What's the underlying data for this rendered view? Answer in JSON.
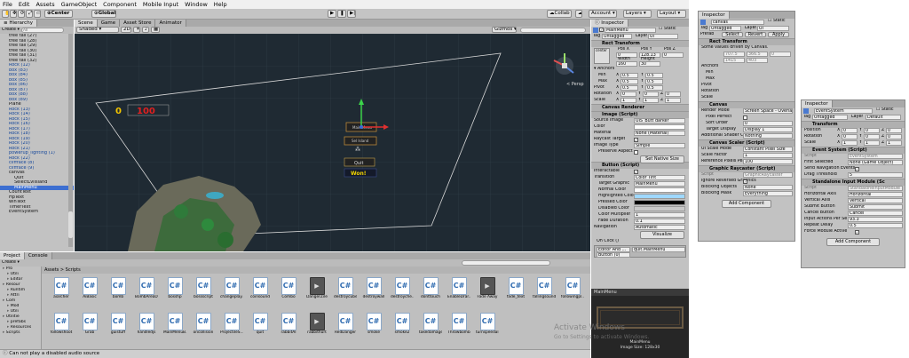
{
  "menu": [
    "File",
    "Edit",
    "Assets",
    "GameObject",
    "Component",
    "Mobile Input",
    "Window",
    "Help"
  ],
  "toolbar": {
    "center": "Center",
    "global": "Global",
    "collab": "Collab",
    "account": "Account",
    "layers": "Layers",
    "layout": "Layout"
  },
  "hierarchy": {
    "tab": "Hierarchy",
    "create": "Create",
    "search_placeholder": "All",
    "items": [
      {
        "label": "tree tall (27)",
        "kind": "normal"
      },
      {
        "label": "tree tall (28)",
        "kind": "normal"
      },
      {
        "label": "tree tall (29)",
        "kind": "normal"
      },
      {
        "label": "tree tall (30)",
        "kind": "normal"
      },
      {
        "label": "tree tall (31)",
        "kind": "normal"
      },
      {
        "label": "tree tall (32)",
        "kind": "normal"
      },
      {
        "label": "Rock (12)",
        "kind": "blue"
      },
      {
        "label": "box (83)",
        "kind": "blue"
      },
      {
        "label": "box (84)",
        "kind": "blue"
      },
      {
        "label": "box (85)",
        "kind": "blue"
      },
      {
        "label": "box (86)",
        "kind": "blue"
      },
      {
        "label": "box (87)",
        "kind": "blue"
      },
      {
        "label": "box (88)",
        "kind": "blue"
      },
      {
        "label": "box (89)",
        "kind": "blue"
      },
      {
        "label": "Plane",
        "kind": "normal"
      },
      {
        "label": "Rock (13)",
        "kind": "blue"
      },
      {
        "label": "Rock (14)",
        "kind": "blue"
      },
      {
        "label": "Rock (15)",
        "kind": "blue"
      },
      {
        "label": "Rock (16)",
        "kind": "blue"
      },
      {
        "label": "Rock (17)",
        "kind": "blue"
      },
      {
        "label": "Rock (18)",
        "kind": "blue"
      },
      {
        "label": "Rock (19)",
        "kind": "blue"
      },
      {
        "label": "Rock (20)",
        "kind": "blue"
      },
      {
        "label": "Rock (21)",
        "kind": "blue"
      },
      {
        "label": "powerup_lighting (1)",
        "kind": "blue"
      },
      {
        "label": "Rock (22)",
        "kind": "blue"
      },
      {
        "label": "cliffface (8)",
        "kind": "blue"
      },
      {
        "label": "cliffface (9)",
        "kind": "blue"
      },
      {
        "label": "canvas",
        "kind": "normal"
      },
      {
        "label": "Quit",
        "kind": "normal"
      },
      {
        "label": "SelectLvlIsland",
        "kind": "normal"
      },
      {
        "label": "MainMenu",
        "kind": "sel"
      },
      {
        "label": "CountText",
        "kind": "normal"
      },
      {
        "label": "HpText",
        "kind": "normal"
      },
      {
        "label": "winText",
        "kind": "normal"
      },
      {
        "label": "TimerText",
        "kind": "normal"
      },
      {
        "label": "EventSystem",
        "kind": "normal"
      }
    ]
  },
  "scene": {
    "tabs": [
      "Scene",
      "Game",
      "Asset Store",
      "Animator"
    ],
    "shaded": "Shaded",
    "twod": "2D",
    "gizmos": "Gizmos",
    "persp": "< Persp",
    "hud_count": "0",
    "hud_hp": "100",
    "btn_main": "Main Menu",
    "btn_lvl": "Sel Island",
    "btn_quit": "Quit",
    "btn_won": "Won!"
  },
  "project": {
    "tabs": [
      "Project",
      "Console"
    ],
    "create": "Create",
    "path": "Assets > Scripts",
    "tree": [
      "Pro",
      "Utili",
      "Editor",
      "Resour",
      "Runtim",
      "Attri",
      "Com",
      "Mod",
      "Utili",
      "Utilitie",
      "prefabs",
      "Resources",
      "Scripts"
    ],
    "assets": [
      {
        "name": "aiarcher",
        "type": "cs"
      },
      {
        "name": "AiBasic",
        "type": "cs"
      },
      {
        "name": "bomb",
        "type": "cs"
      },
      {
        "name": "BombAreaD...",
        "type": "cs"
      },
      {
        "name": "bosshp",
        "type": "cs"
      },
      {
        "name": "bossscript",
        "type": "cs"
      },
      {
        "name": "changeplay...",
        "type": "cs"
      },
      {
        "name": "coinsound",
        "type": "cs"
      },
      {
        "name": "Combo",
        "type": "cs"
      },
      {
        "name": "DangerZile",
        "type": "vid"
      },
      {
        "name": "destroycube",
        "type": "cs"
      },
      {
        "name": "destroywall",
        "type": "cs"
      },
      {
        "name": "destroyche...",
        "type": "cs"
      },
      {
        "name": "donttouch",
        "type": "cs"
      },
      {
        "name": "EnableDrar...",
        "type": "cs"
      },
      {
        "name": "Fade Away",
        "type": "vid"
      },
      {
        "name": "fade_text",
        "type": "cs"
      },
      {
        "name": "fallingsound",
        "type": "cs"
      },
      {
        "name": "followingpl...",
        "type": "cs"
      },
      {
        "name": "followshoot",
        "type": "cs"
      },
      {
        "name": "Grab",
        "type": "cs"
      },
      {
        "name": "guistuff",
        "type": "cs"
      },
      {
        "name": "handledjs",
        "type": "cs"
      },
      {
        "name": "MainMenuB...",
        "type": "cs"
      },
      {
        "name": "oncollision",
        "type": "cs"
      },
      {
        "name": "ProjectileS...",
        "type": "cs"
      },
      {
        "name": "quit",
        "type": "cs"
      },
      {
        "name": "rabbitAI",
        "type": "cs"
      },
      {
        "name": "rabbithurt",
        "type": "vid"
      },
      {
        "name": "RedDanger",
        "type": "cs"
      },
      {
        "name": "smoke",
        "type": "cs"
      },
      {
        "name": "smoke2",
        "type": "cs"
      },
      {
        "name": "takedamage",
        "type": "cs"
      },
      {
        "name": "Throwbomb",
        "type": "cs"
      },
      {
        "name": "turnspeedal...",
        "type": "cs"
      }
    ]
  },
  "status": "Can not play a disabled audio source",
  "inspector": {
    "tab": "Inspector",
    "name": "MainMenu",
    "static": "Static",
    "tag": "Untagged",
    "layer": "UI",
    "rect": {
      "title": "Rect Transform",
      "anchor": "center",
      "posx": "0",
      "posy": "128.13",
      "posz": "0",
      "width": "160",
      "height": "30"
    },
    "anchors": {
      "title": "Anchors",
      "min_x": "0.5",
      "min_y": "0.5",
      "max_x": "0.5",
      "max_y": "0.5",
      "pivot_x": "0.5",
      "pivot_y": "0.5"
    },
    "rotation": {
      "x": "0",
      "y": "0",
      "z": "0"
    },
    "scale": {
      "x": "1",
      "y": "1",
      "z": "1"
    },
    "canvas_renderer": "Canvas Renderer",
    "image": {
      "title": "Image (Script)",
      "source": "UIS_Butt darker",
      "material": "None (Material)",
      "image_type": "Simple",
      "set_native": "Set Native Size"
    },
    "button": {
      "title": "Button (Script)",
      "transition": "Color Tint",
      "target": "MainMenu",
      "fade": "0.1",
      "navigation": "Automatic",
      "visualize": "Visualize"
    },
    "onclick": "On Click ()",
    "editor": "Editor And ...",
    "func": "quit.MainMenu",
    "objref": "Button (0)",
    "labels": {
      "source_image": "Source Image",
      "color": "Color",
      "material": "Material",
      "raycast": "Raycast Target",
      "image_type": "Image Type",
      "preserve": "Preserve Aspect",
      "interactable": "Interactable",
      "transition": "Transition",
      "target_graphic": "Target Graphic",
      "normal": "Normal Color",
      "highlighted": "Highlighted Color",
      "pressed": "Pressed Color",
      "disabled": "Disabled Color",
      "multiplier": "Color Multiplier",
      "fade": "Fade Duration",
      "navigation": "Navigation",
      "anchors_min": "Min",
      "anchors_max": "Max",
      "pivot": "Pivot",
      "rotation": "Rotation",
      "scale": "Scale",
      "posx": "Pos X",
      "posy": "Pos Y",
      "posz": "Pos Z",
      "width": "Width",
      "height": "Height"
    },
    "multiplier": "1"
  },
  "preview": {
    "title": "MainMenu",
    "info": "MainMenu",
    "size": "Image Size: 128x30"
  },
  "watermark": {
    "line1": "Activate Windows",
    "line2": "Go to Settings to activate Windows."
  },
  "inspector2": {
    "tab": "Inspector",
    "name": "canvas",
    "static": "Static",
    "tag": "Untagged",
    "layer": "UI",
    "prefab": "Prefab",
    "select": "Select",
    "revert": "Revert",
    "apply": "Apply",
    "rect_title": "Rect Transform",
    "rect_note": "Some values driven by Canvas.",
    "posx": "707.5",
    "posy": "366.5",
    "posz": "0",
    "width": "1415",
    "height": "403",
    "canvas_title": "Canvas",
    "render_mode": "Screen Space - Overlay",
    "pixel_perfect": "Pixel Perfect",
    "sort_order": "0",
    "target_display": "Display 1",
    "additional": "Nothing",
    "scaler_title": "Canvas Scaler (Script)",
    "ui_scale": "Constant Pixel Size",
    "scale_factor": "1",
    "ref_ppu": "100",
    "raycaster_title": "Graphic Raycaster (Script)",
    "script": "GraphicRaycaster",
    "ignore_reversed": "Ignore Reversed Graphics",
    "blocking_objects": "None",
    "blocking_mask": "Everything",
    "add_component": "Add Component",
    "labels": {
      "render_mode": "Render Mode",
      "sort_order": "Sort Order",
      "target_display": "Target Display",
      "additional": "Additional Shader Ch",
      "ui_scale_mode": "UI Scale Mode",
      "scale_factor": "Scale Factor",
      "ref_ppu": "Reference Pixels Per",
      "blocking_objects": "Blocking Objects",
      "blocking_mask": "Blocking Mask",
      "script": "Script",
      "anchors": "Anchors",
      "min": "Min",
      "max": "Max",
      "pivot": "Pivot",
      "rotation": "Rotation",
      "scale": "Scale"
    }
  },
  "inspector3": {
    "tab": "Inspector",
    "name": "EventSystem",
    "static": "Static",
    "tag": "Untagged",
    "layer": "Default",
    "transform": "Transform",
    "pos": {
      "x": "0",
      "y": "0",
      "z": "0"
    },
    "rot": {
      "x": "0",
      "y": "0",
      "z": "0"
    },
    "scale": {
      "x": "1",
      "y": "1",
      "z": "1"
    },
    "es_title": "Event System (Script)",
    "es_script": "EventSystem",
    "first_selected": "None (Game Object)",
    "send_nav": "Send Navigation Events",
    "drag_threshold": "5",
    "sim_title": "Standalone Input Module (Sc",
    "sim_script": "StandaloneInputModule",
    "horizontal": "Horizontal",
    "vertical": "Vertical",
    "submit": "Submit",
    "cancel": "Cancel",
    "ips": "93.3",
    "repeat": "0.5",
    "force": "Force Module Active",
    "add_component": "Add Component",
    "labels": {
      "position": "Position",
      "rotation": "Rotation",
      "scale": "Scale",
      "script": "Script",
      "first_selected": "First Selected",
      "drag_threshold": "Drag Threshold",
      "horizontal": "Horizontal Axis",
      "vertical": "Vertical Axis",
      "submit": "Submit Button",
      "cancel": "Cancel Button",
      "ips": "Input Actions Per Se",
      "repeat": "Repeat Delay"
    }
  }
}
